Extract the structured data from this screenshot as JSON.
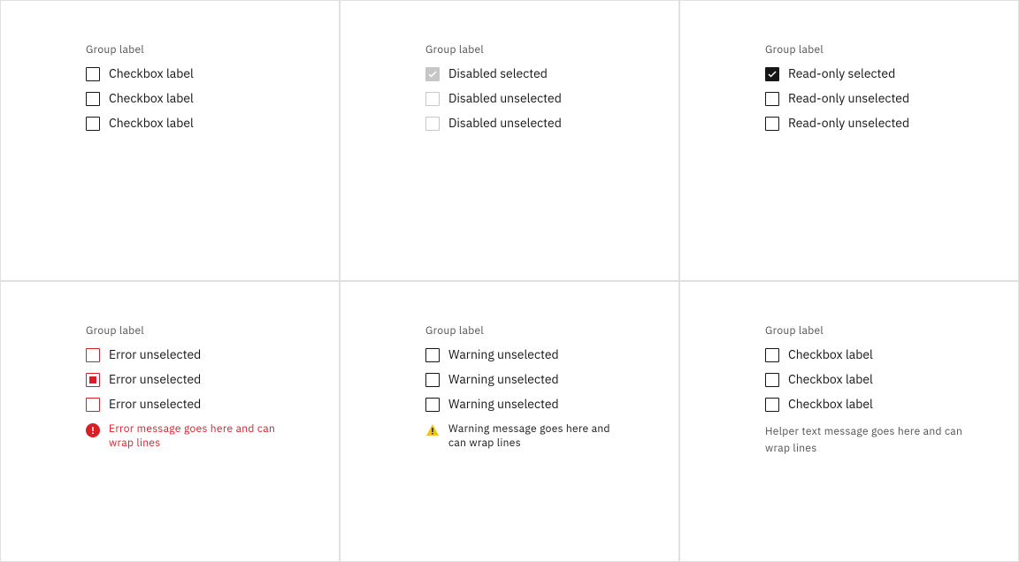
{
  "cells": [
    {
      "group_label": "Group label",
      "items": [
        {
          "label": "Checkbox label"
        },
        {
          "label": "Checkbox label"
        },
        {
          "label": "Checkbox label"
        }
      ]
    },
    {
      "group_label": "Group label",
      "items": [
        {
          "label": "Disabled selected"
        },
        {
          "label": "Disabled unselected"
        },
        {
          "label": "Disabled unselected"
        }
      ]
    },
    {
      "group_label": "Group label",
      "items": [
        {
          "label": "Read-only selected"
        },
        {
          "label": "Read-only unselected"
        },
        {
          "label": "Read-only unselected"
        }
      ]
    },
    {
      "group_label": "Group label",
      "items": [
        {
          "label": "Error unselected"
        },
        {
          "label": "Error unselected"
        },
        {
          "label": "Error unselected"
        }
      ],
      "message": "Error message goes here and can wrap lines"
    },
    {
      "group_label": "Group label",
      "items": [
        {
          "label": "Warning unselected"
        },
        {
          "label": "Warning unselected"
        },
        {
          "label": "Warning unselected"
        }
      ],
      "message": "Warning message goes here and can wrap lines"
    },
    {
      "group_label": "Group label",
      "items": [
        {
          "label": "Checkbox label"
        },
        {
          "label": "Checkbox label"
        },
        {
          "label": "Checkbox label"
        }
      ],
      "message": "Helper text message goes here and can wrap lines"
    }
  ]
}
